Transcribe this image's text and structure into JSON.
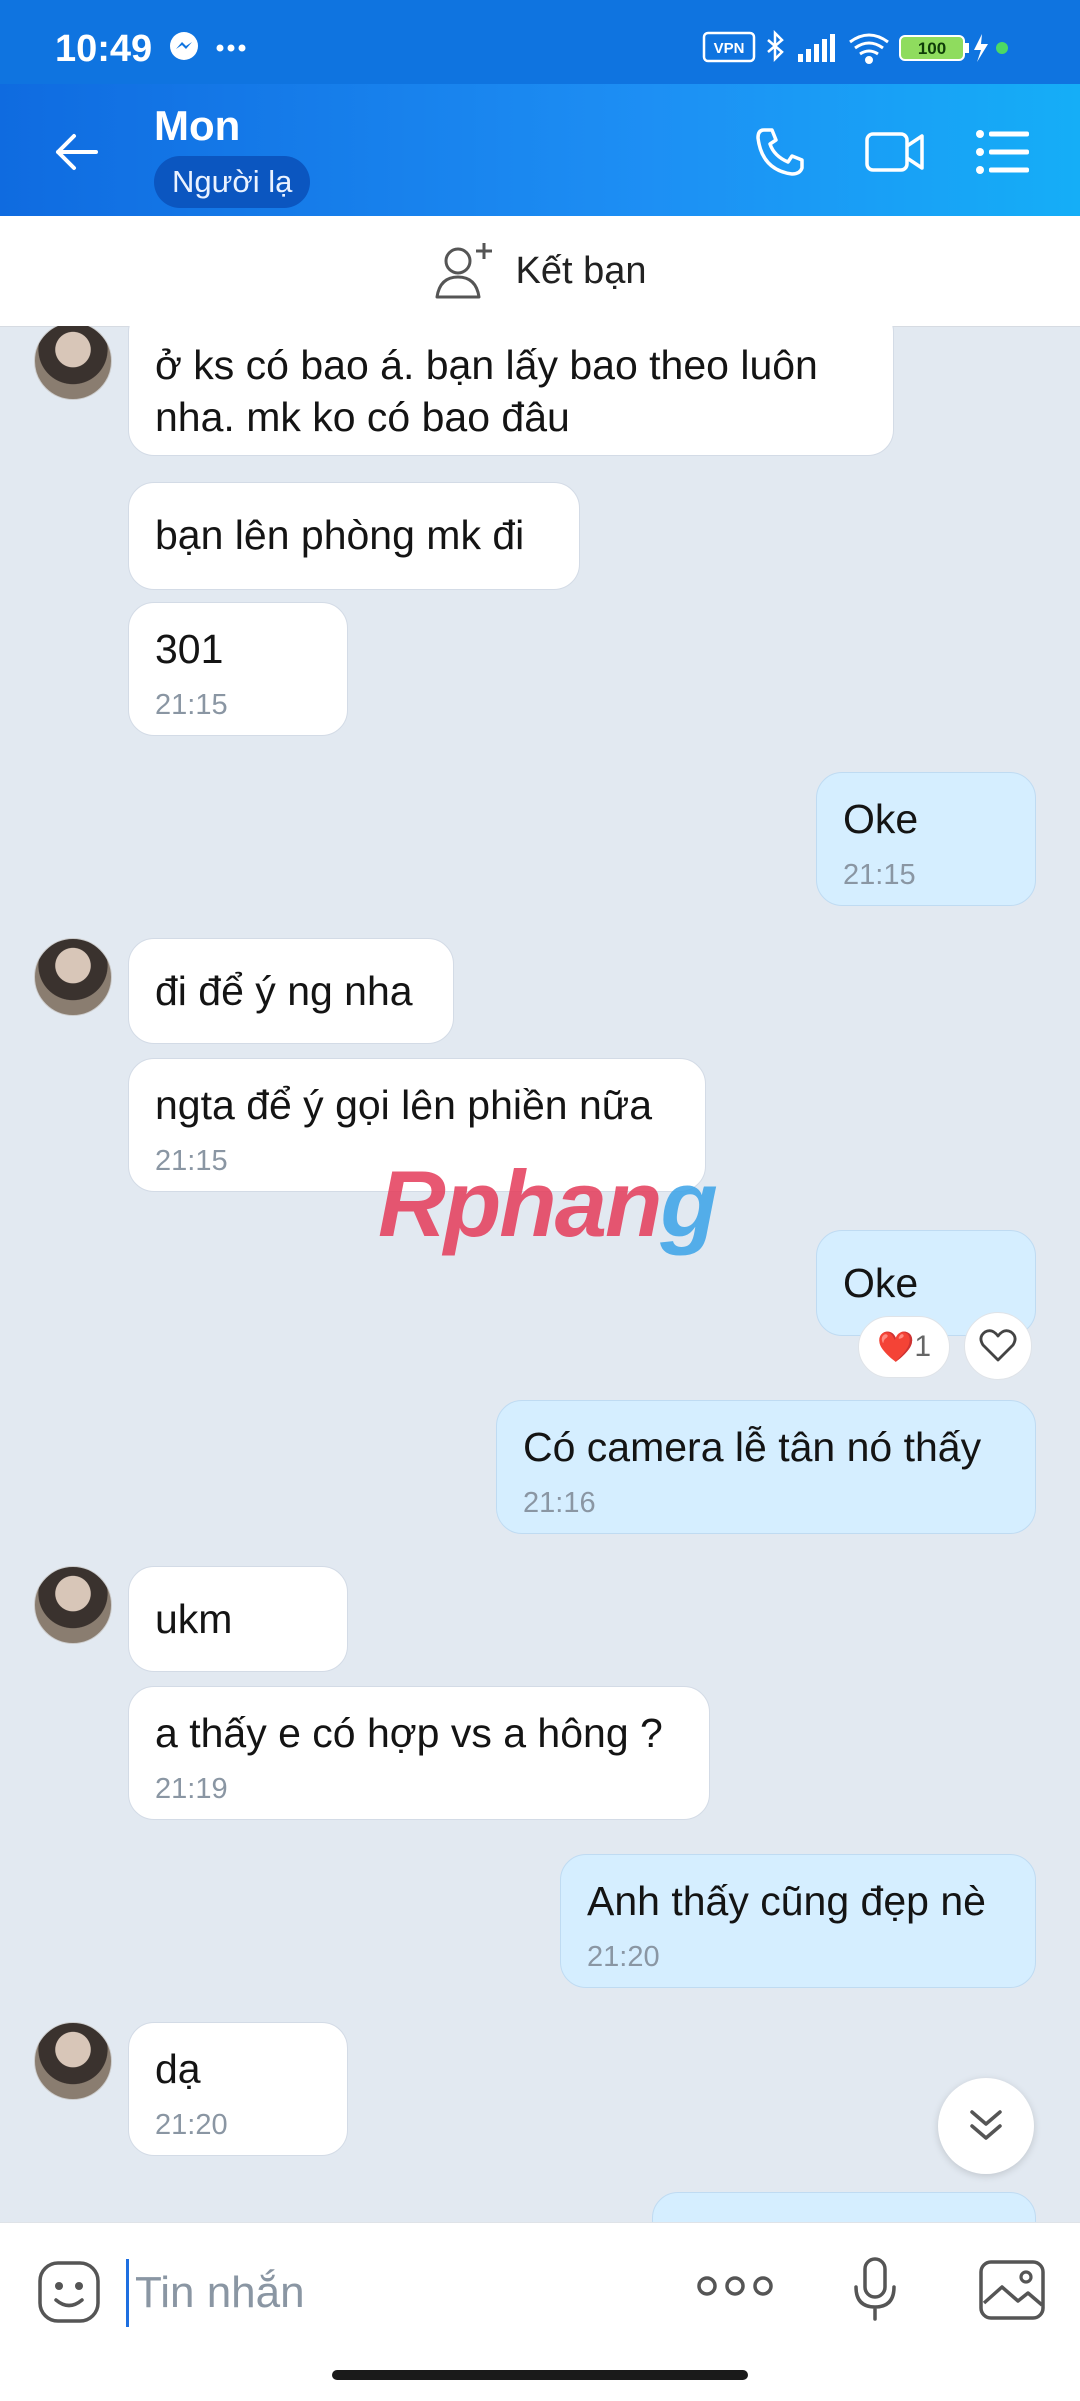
{
  "status_bar": {
    "time": "10:49",
    "battery": "100",
    "vpn": "VPN"
  },
  "header": {
    "contact_name": "Mon",
    "tag": "Người lạ"
  },
  "add_friend": {
    "label": "Kết bạn"
  },
  "messages": [
    {
      "dir": "in",
      "text_lines": [
        "ở ks có bao á. bạn lấy bao theo luôn",
        "nha. mk ko có bao đâu"
      ],
      "time": ""
    },
    {
      "dir": "in",
      "text_lines": [
        "bạn lên phòng mk đi"
      ],
      "time": ""
    },
    {
      "dir": "in",
      "text_lines": [
        "301"
      ],
      "time": "21:15"
    },
    {
      "dir": "out",
      "text_lines": [
        "Oke"
      ],
      "time": "21:15"
    },
    {
      "dir": "in",
      "text_lines": [
        "đi để ý ng nha"
      ],
      "time": ""
    },
    {
      "dir": "in",
      "text_lines": [
        "ngta để ý gọi lên phiền nữa"
      ],
      "time": "21:15"
    },
    {
      "dir": "out",
      "text_lines": [
        "Oke"
      ],
      "time": "",
      "reaction": {
        "emoji": "❤️",
        "count": "1"
      }
    },
    {
      "dir": "out",
      "text_lines": [
        "Có camera lễ tân nó thấy"
      ],
      "time": "21:16"
    },
    {
      "dir": "in",
      "text_lines": [
        "ukm"
      ],
      "time": ""
    },
    {
      "dir": "in",
      "text_lines": [
        "a thấy e có hợp vs a hông ?"
      ],
      "time": "21:19"
    },
    {
      "dir": "out",
      "text_lines": [
        "Anh thấy cũng đẹp nè"
      ],
      "time": "21:20"
    },
    {
      "dir": "in",
      "text_lines": [
        "dạ"
      ],
      "time": "21:20"
    }
  ],
  "watermark": {
    "part1": "Rphan",
    "part2": "g"
  },
  "composer": {
    "placeholder": "Tin nhắn"
  },
  "colors": {
    "header": "#0f74e0",
    "outgoing_bubble": "#d5eeff",
    "incoming_bubble": "#ffffff",
    "chat_bg": "#e2e9f1"
  }
}
